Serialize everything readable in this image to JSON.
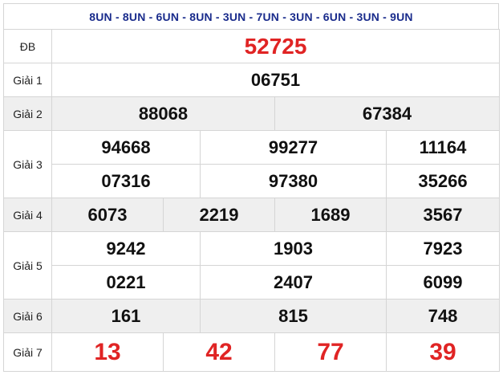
{
  "header": "8UN - 8UN - 6UN - 8UN - 3UN - 7UN - 3UN - 6UN - 3UN - 9UN",
  "labels": {
    "db": "ĐB",
    "g1": "Giải 1",
    "g2": "Giải 2",
    "g3": "Giải 3",
    "g4": "Giải 4",
    "g5": "Giải 5",
    "g6": "Giải 6",
    "g7": "Giải 7"
  },
  "prizes": {
    "db": [
      "52725"
    ],
    "g1": [
      "06751"
    ],
    "g2": [
      "88068",
      "67384"
    ],
    "g3": [
      "94668",
      "99277",
      "11164",
      "07316",
      "97380",
      "35266"
    ],
    "g4": [
      "6073",
      "2219",
      "1689",
      "3567"
    ],
    "g5": [
      "9242",
      "1903",
      "7923",
      "0221",
      "2407",
      "6099"
    ],
    "g6": [
      "161",
      "815",
      "748"
    ],
    "g7": [
      "13",
      "42",
      "77",
      "39"
    ]
  },
  "colors": {
    "header_text": "#1a2c8c",
    "highlight_red": "#e02424",
    "row_shade": "#efefef",
    "border": "#d5d5d5"
  }
}
